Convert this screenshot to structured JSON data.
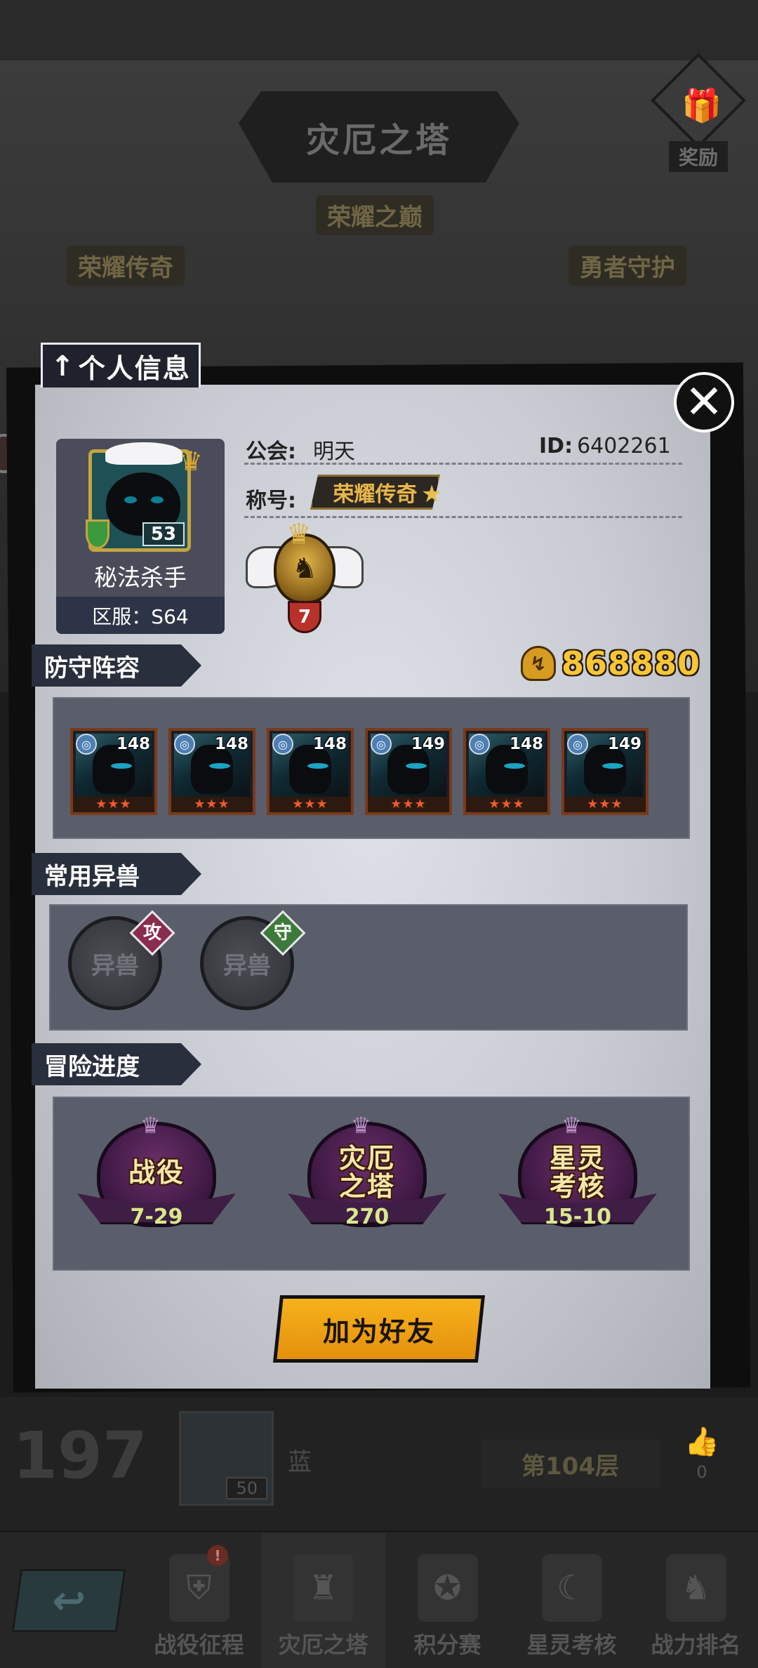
{
  "background": {
    "tower_title": "灾厄之塔",
    "reward_label": "奖励",
    "ribbons": [
      "荣耀之巅",
      "荣耀传奇",
      "勇者守护"
    ],
    "ranking_row": {
      "rank": "197",
      "avatar_level": "50",
      "name": "蓝",
      "floor": "第104层",
      "likes": "0"
    },
    "nav": {
      "tabs": [
        {
          "label": "战役征程",
          "icon": "campaign-icon",
          "alert": "!"
        },
        {
          "label": "灾厄之塔",
          "icon": "tower-icon",
          "active": true
        },
        {
          "label": "积分赛",
          "icon": "points-icon"
        },
        {
          "label": "星灵考核",
          "icon": "moon-icon"
        },
        {
          "label": "战力排名",
          "icon": "power-rank-icon"
        }
      ]
    }
  },
  "dialog": {
    "title": "个人信息",
    "close_label": "✕",
    "profile": {
      "avatar_level": "53",
      "name": "秘法杀手",
      "server": "区服：S64",
      "guild_label": "公会:",
      "guild_value": "明天",
      "id_label": "ID:",
      "id_value": "6402261",
      "title_label": "称号:",
      "title_value": "荣耀传奇",
      "rank_level": "7"
    },
    "defense": {
      "section_title": "防守阵容",
      "power": "868880",
      "heroes": [
        {
          "level": "148",
          "stars": "★★★"
        },
        {
          "level": "148",
          "stars": "★★★"
        },
        {
          "level": "148",
          "stars": "★★★"
        },
        {
          "level": "149",
          "stars": "★★★"
        },
        {
          "level": "148",
          "stars": "★★★"
        },
        {
          "level": "149",
          "stars": "★★★"
        }
      ]
    },
    "beasts": {
      "section_title": "常用异兽",
      "slots": [
        {
          "label": "异兽",
          "tag": "攻",
          "tag_color": "#8a2c4e"
        },
        {
          "label": "异兽",
          "tag": "守",
          "tag_color": "#3d7a3a"
        }
      ]
    },
    "adventure": {
      "section_title": "冒险进度",
      "items": [
        {
          "name": "战役",
          "value": "7-29"
        },
        {
          "name": "灾厄之塔",
          "value": "270"
        },
        {
          "name": "星灵考核",
          "value": "15-10"
        }
      ]
    },
    "add_friend_label": "加为好友"
  }
}
